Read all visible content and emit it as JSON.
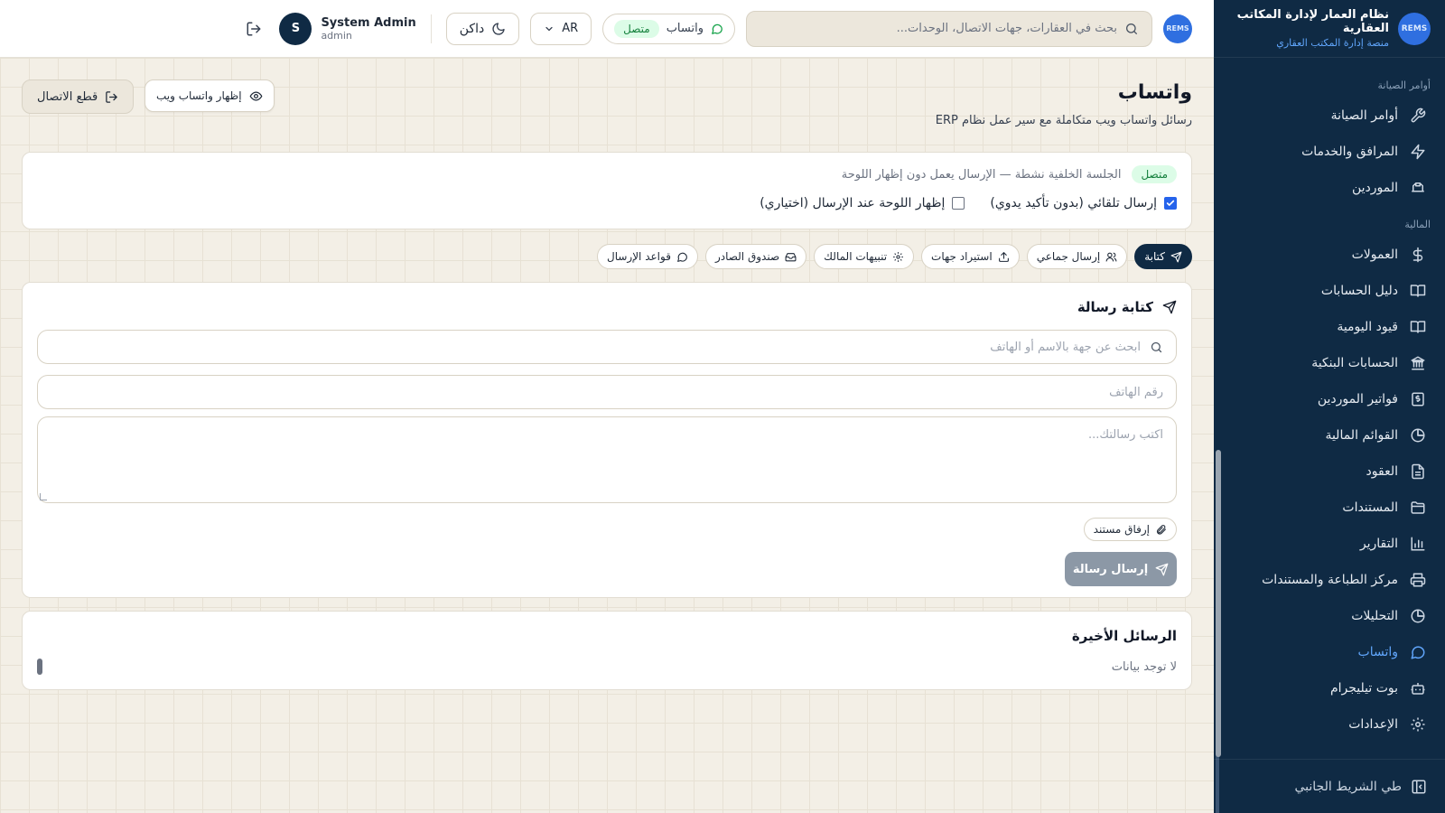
{
  "sidebar": {
    "brand_title": "نظام العمار لإدارة المكاتب العقارية",
    "brand_sub": "منصة إدارة المكتب العقاري",
    "logo_text": "REMS",
    "sections": [
      {
        "title": "أوامر الصيانة",
        "items": [
          {
            "label": "أوامر الصيانة",
            "icon": "wrench-icon"
          },
          {
            "label": "المرافق والخدمات",
            "icon": "zap-icon"
          },
          {
            "label": "الموردين",
            "icon": "truck-icon"
          }
        ]
      },
      {
        "title": "المالية",
        "items": [
          {
            "label": "العمولات",
            "icon": "dollar-icon"
          },
          {
            "label": "دليل الحسابات",
            "icon": "book-icon"
          },
          {
            "label": "قيود اليومية",
            "icon": "book-open-icon"
          },
          {
            "label": "الحسابات البنكية",
            "icon": "bank-icon"
          },
          {
            "label": "فواتير الموردين",
            "icon": "receipt-icon"
          },
          {
            "label": "القوائم المالية",
            "icon": "pie-icon"
          },
          {
            "label": "العقود",
            "icon": "file-icon"
          },
          {
            "label": "المستندات",
            "icon": "folder-icon"
          },
          {
            "label": "التقارير",
            "icon": "bar-chart-icon"
          },
          {
            "label": "مركز الطباعة والمستندات",
            "icon": "printer-icon"
          },
          {
            "label": "التحليلات",
            "icon": "analytics-icon"
          },
          {
            "label": "واتساب",
            "icon": "message-icon",
            "active": true
          },
          {
            "label": "بوت تيليجرام",
            "icon": "bot-icon"
          },
          {
            "label": "الإعدادات",
            "icon": "gear-icon"
          }
        ]
      }
    ],
    "collapse_label": "طي الشريط الجانبي"
  },
  "header": {
    "logo_text": "REMS",
    "search_placeholder": "بحث في العقارات، جهات الاتصال، الوحدات...",
    "whatsapp_label": "واتساب",
    "whatsapp_status": "متصل",
    "lang_label": "AR",
    "theme_label": "داكن",
    "user_initial": "S",
    "user_name": "System Admin",
    "user_role": "admin"
  },
  "main": {
    "title": "واتساب",
    "subtitle": "رسائل واتساب ويب متكاملة مع سير عمل نظام ERP",
    "disconnect_label": "قطع الاتصال",
    "show_web_label": "إظهار واتساب ويب",
    "status": {
      "badge": "متصل",
      "text": "الجلسة الخلفية نشطة — الإرسال يعمل دون إظهار اللوحة",
      "auto_send_label": "إرسال تلقائي (بدون تأكيد يدوي)",
      "auto_send_checked": true,
      "show_panel_label": "إظهار اللوحة عند الإرسال (اختياري)",
      "show_panel_checked": false
    },
    "tabs": [
      {
        "label": "كتابة",
        "icon": "send-icon",
        "active": true
      },
      {
        "label": "إرسال جماعي",
        "icon": "users-icon"
      },
      {
        "label": "استيراد جهات",
        "icon": "upload-icon"
      },
      {
        "label": "تنبيهات المالك",
        "icon": "gear-icon"
      },
      {
        "label": "صندوق الصادر",
        "icon": "inbox-icon"
      },
      {
        "label": "قواعد الإرسال",
        "icon": "message-icon"
      }
    ],
    "compose": {
      "title": "كتابة رسالة",
      "contact_search_placeholder": "ابحث عن جهة بالاسم أو الهاتف",
      "phone_placeholder": "رقم الهاتف",
      "message_placeholder": "اكتب رسالتك...",
      "attach_label": "إرفاق مستند",
      "send_label": "إرسال رسالة"
    },
    "recent": {
      "title": "الرسائل الأخيرة",
      "empty": "لا توجد بيانات"
    }
  },
  "colors": {
    "sidebar_bg": "#0f2a44",
    "accent": "#2563eb",
    "active_link": "#60a5fa",
    "success": "#16a34a",
    "page_bg": "#f3efe6"
  }
}
